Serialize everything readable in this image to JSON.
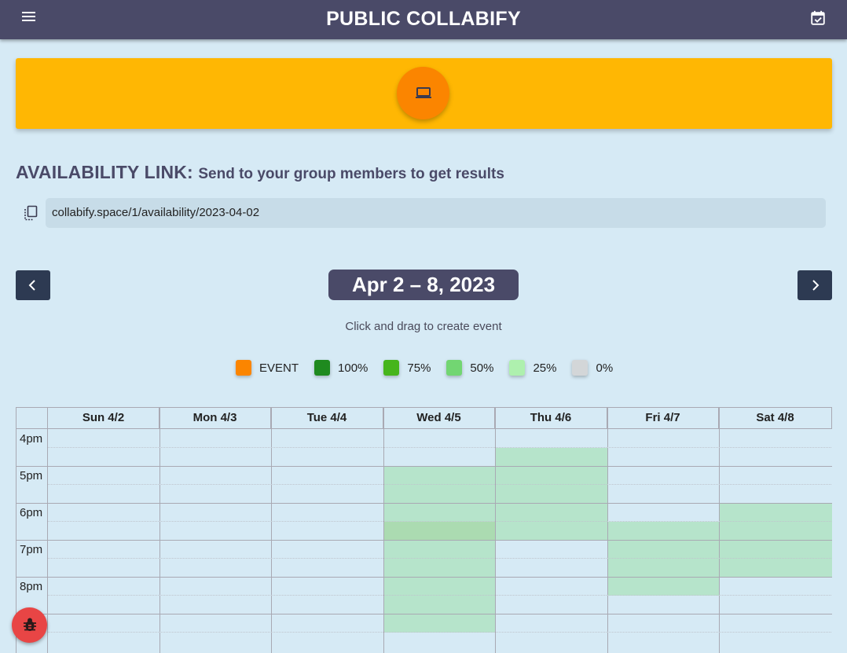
{
  "header": {
    "title": "PUBLIC COLLABIFY",
    "menu_icon": "menu-icon",
    "calendar_icon": "calendar-check-icon"
  },
  "banner": {
    "color": "#ffb703",
    "fab_color": "#fb8500",
    "fab_icon": "laptop-icon"
  },
  "availability": {
    "heading": "AVAILABILITY LINK:",
    "subheading": "Send to your group members to get results",
    "link": "collabify.space/1/availability/2023-04-02",
    "copy_icon": "copy-icon"
  },
  "week": {
    "range": "Apr 2 – 8, 2023",
    "prev_icon": "chevron-left-icon",
    "next_icon": "chevron-right-icon",
    "hint": "Click and drag to create event"
  },
  "legend": [
    {
      "label": "EVENT",
      "color": "#fb8500"
    },
    {
      "label": "100%",
      "color": "#1f8a1f"
    },
    {
      "label": "75%",
      "color": "#46b51c"
    },
    {
      "label": "50%",
      "color": "#72d672"
    },
    {
      "label": "25%",
      "color": "#aef0ae"
    },
    {
      "label": "0%",
      "color": "#d3d6d8"
    }
  ],
  "calendar": {
    "days": [
      "Sun 4/2",
      "Mon 4/3",
      "Tue 4/4",
      "Wed 4/5",
      "Thu 4/6",
      "Fri 4/7",
      "Sat 4/8"
    ],
    "times": [
      "4pm",
      "5pm",
      "6pm",
      "7pm",
      "8pm",
      ""
    ],
    "availability": [
      {
        "day": "Wed 4/5",
        "start": "5:00pm",
        "end": "9:30pm",
        "level": "25%"
      },
      {
        "day": "Wed 4/5",
        "start": "6:30pm",
        "end": "7:00pm",
        "level": "25%"
      },
      {
        "day": "Thu 4/6",
        "start": "4:30pm",
        "end": "7:00pm",
        "level": "25%"
      },
      {
        "day": "Fri 4/7",
        "start": "6:30pm",
        "end": "8:30pm",
        "level": "25%"
      },
      {
        "day": "Sat 4/8",
        "start": "6:00pm",
        "end": "8:00pm",
        "level": "25%"
      }
    ]
  },
  "debug": {
    "icon": "bug-icon",
    "color": "#e84545"
  }
}
